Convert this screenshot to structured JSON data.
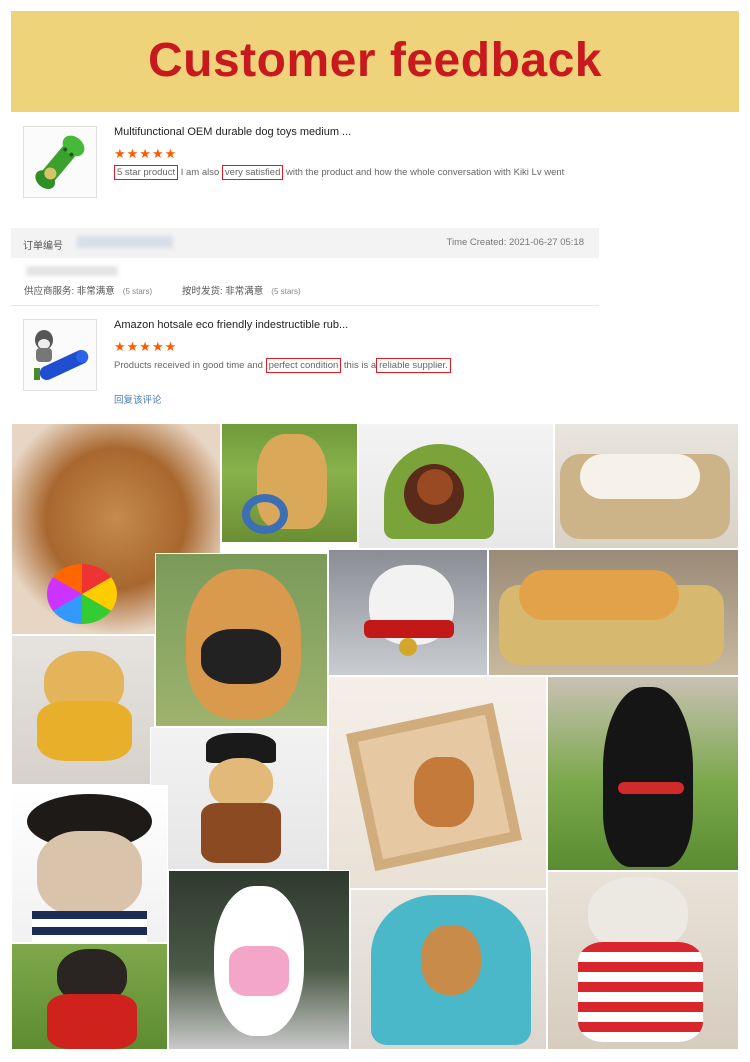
{
  "banner": {
    "title": "Customer feedback",
    "bg": "#eed37a",
    "title_color": "#c8191f"
  },
  "review1": {
    "product_title": "Multifunctional OEM durable dog toys medium ...",
    "stars": "★★★★★",
    "comment_hl1": "5 star product",
    "comment_mid1": " I am also ",
    "comment_hl2": "very satisfied",
    "comment_tail": " with the product and how the whole conversation with Kiki Lv went"
  },
  "order": {
    "label": "订单编号",
    "time_created": "Time Created: 2021-06-27 05:18",
    "supplier_service": "供应商服务: 非常满意",
    "supplier_stars": "(5 stars)",
    "ontime_shipping": "按时发货: 非常满意",
    "shipping_stars": "(5 stars)"
  },
  "review2": {
    "product_title": "Amazon hotsale eco friendly indestructible rub...",
    "stars": "★★★★★",
    "comment_pre": "Products received in good time and ",
    "comment_hl1": "perfect condition",
    "comment_mid": " this is a",
    "comment_hl2": "reliable supplier.",
    "reply_link": "回复该评论"
  },
  "colors": {
    "star": "#ff5a00",
    "highlight_border": "#e21b23",
    "link": "#4a7ab8"
  },
  "photos": [
    "poodle-with-rainbow-ball-toy",
    "golden-retriever-with-rope-ring",
    "poodle-in-green-cat-cave-bed",
    "dog-sleeping-on-cushion-bed",
    "shiba-inu-with-muzzle",
    "grey-cat-with-red-bow-collar",
    "golden-dog-on-plush-bed",
    "teddy-dog-in-bear-costume",
    "chihuahua-in-wooden-house",
    "black-labrador-with-red-collar",
    "dog-in-pirate-costume",
    "bulldog-with-curly-wig",
    "poodle-in-pink-harness",
    "spaniel-under-blue-towel",
    "poodle-in-striped-sailor-shirt",
    "french-bulldog-in-red-harness"
  ]
}
